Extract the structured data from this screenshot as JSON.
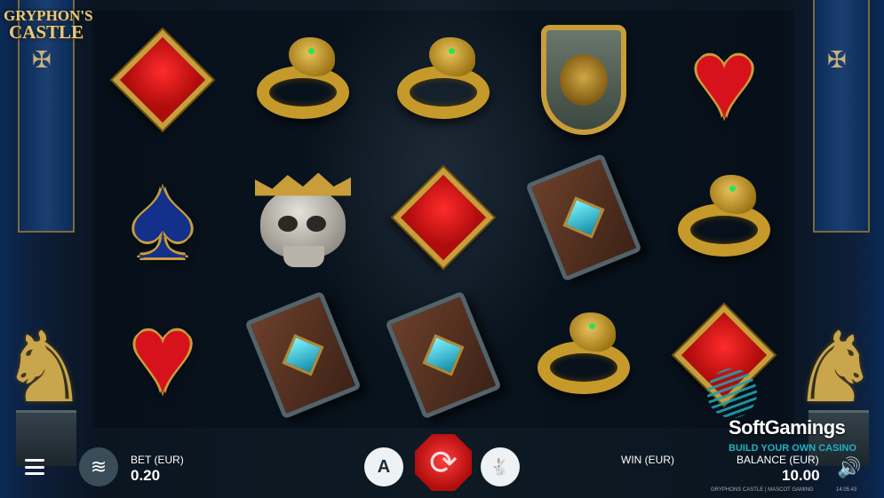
{
  "game": {
    "logo_line1": "GRYPHON'S",
    "logo_line2": "CASTLE"
  },
  "reels": [
    [
      "red-diamond",
      "gold-eagle-ring",
      "gold-eagle-ring",
      "lion-shield",
      "red-heart"
    ],
    [
      "blue-spade",
      "crowned-skull",
      "red-diamond",
      "spell-book",
      "gold-eagle-ring"
    ],
    [
      "red-heart",
      "spell-book",
      "spell-book",
      "gold-eagle-ring",
      "red-diamond"
    ]
  ],
  "controls": {
    "bet_label": "BET (EUR)",
    "bet_value": "0.20",
    "win_label": "WIN (EUR)",
    "balance_label": "BALANCE (EUR)",
    "balance_value": "10.00",
    "auto_label": "A"
  },
  "watermark": {
    "name": "SoftGamings",
    "tagline": "BUILD YOUR OWN CASINO"
  },
  "footer": {
    "game_info": "GRYPHONS CASTLE | MASCOT GAMING",
    "time": "14:05:43"
  },
  "colors": {
    "spin_button": "#c8141a",
    "gold": "#c89d3a",
    "brand_teal": "#1fb2c4"
  }
}
